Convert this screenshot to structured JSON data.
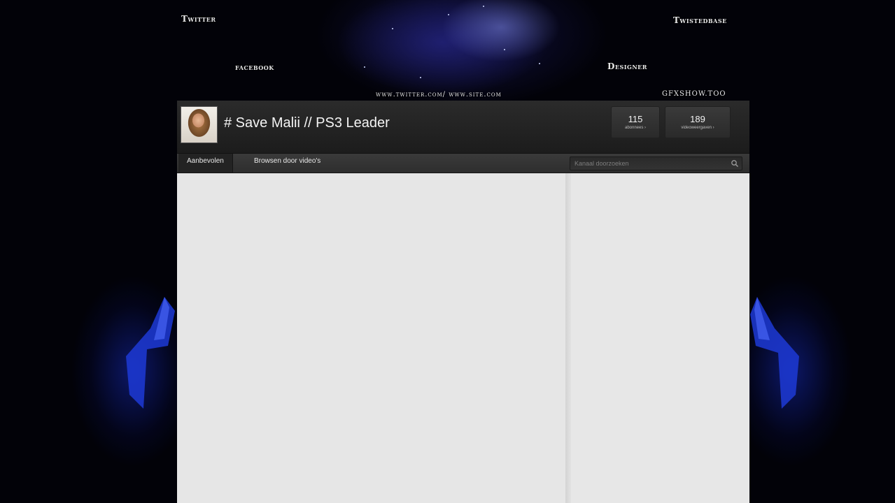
{
  "background": {
    "links": {
      "twitter": "Twitter",
      "facebook": "facebook",
      "twisted": "Twistedbase",
      "designer": "Designer",
      "url_center": "www.twitter.com/ www.site.com",
      "url_right": "GFXSHOW.TOO"
    }
  },
  "channel": {
    "title": "# Save Malii // PS3 Leader",
    "stats": {
      "subscribers_count": "115",
      "subscribers_label": "abonnees ›",
      "views_count": "189",
      "views_label": "videoweergaven ›"
    },
    "nav": {
      "featured_tab": "Aanbevolen",
      "browse_tab": "Browsen door video's",
      "search_placeholder": "Kanaal doorzoeken"
    }
  },
  "colors": {
    "header_bg": "#232323",
    "body_bg": "#e6e6e6",
    "accent_blue": "#1f3fd8"
  }
}
